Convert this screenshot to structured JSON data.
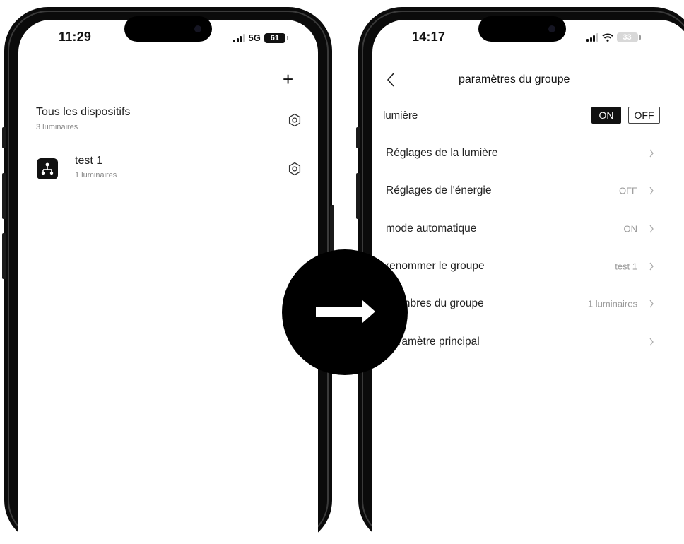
{
  "left_phone": {
    "status_bar": {
      "time": "11:29",
      "network": "5G",
      "battery": "61"
    },
    "add_icon": "plus-icon",
    "all_devices": {
      "title": "Tous les dispositifs",
      "subtitle": "3 luminaires"
    },
    "groups": [
      {
        "name": "test 1",
        "subtitle": "1 luminaires",
        "icon": "group-network-icon"
      }
    ]
  },
  "right_phone": {
    "status_bar": {
      "time": "14:17",
      "battery": "33"
    },
    "title": "paramètres du groupe",
    "light": {
      "label": "lumière",
      "on_label": "ON",
      "off_label": "OFF",
      "state": "ON"
    },
    "rows": [
      {
        "label": "Réglages de la lumière",
        "value": ""
      },
      {
        "label": "Réglages de l'énergie",
        "value": "OFF"
      },
      {
        "label": "mode automatique",
        "value": "ON"
      },
      {
        "label": "renommer le groupe",
        "value": "test 1"
      },
      {
        "label": "membres du groupe",
        "value": "1 luminaires"
      },
      {
        "label": "paramètre principal",
        "value": ""
      }
    ]
  },
  "transition_icon": "right-arrow-icon",
  "colors": {
    "frame": "#0b0b0b",
    "accent": "#111111",
    "muted": "#9a9a9a"
  }
}
